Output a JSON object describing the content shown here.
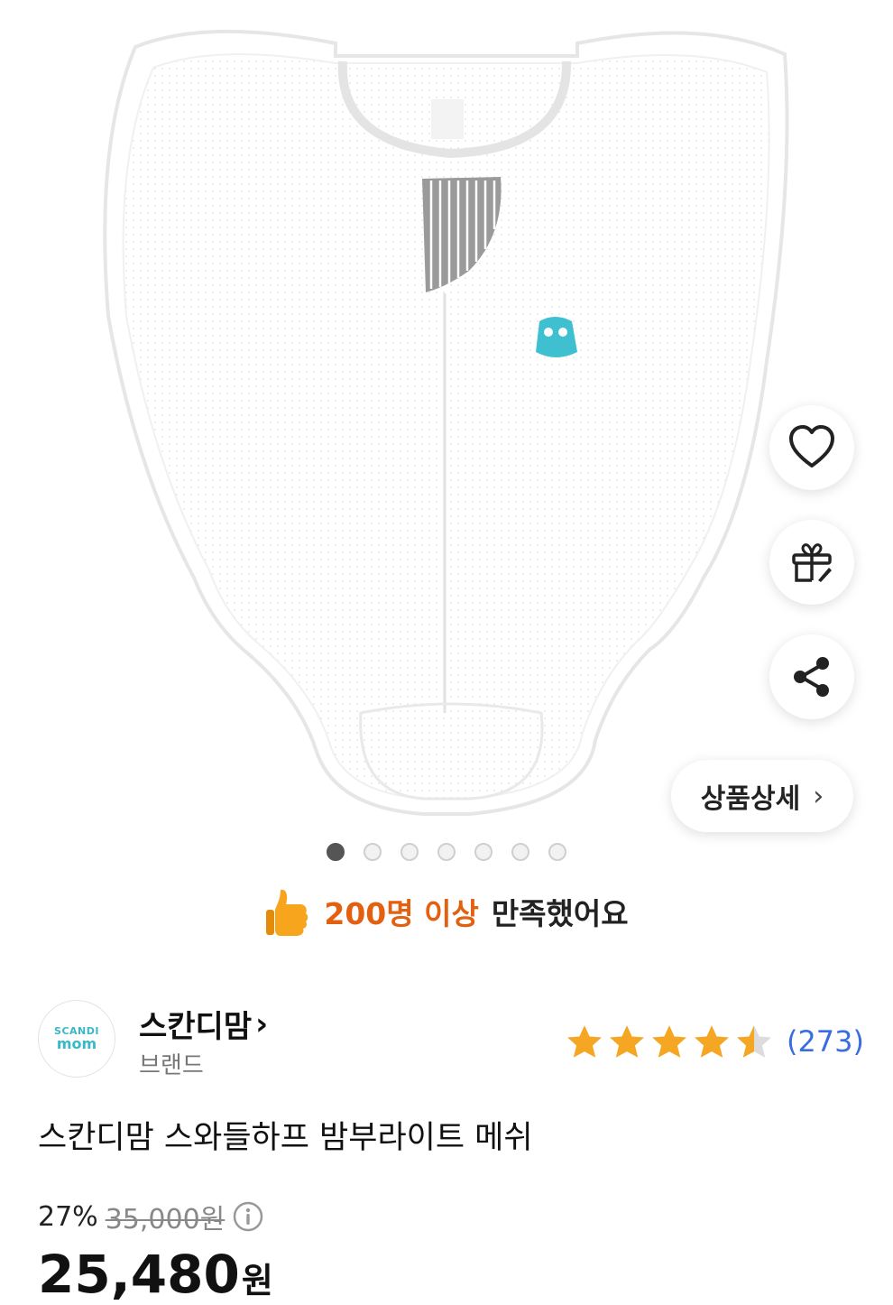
{
  "product_images": {
    "current": 1,
    "total": 7
  },
  "detail_button": {
    "label": "상품상세",
    "chevron": "›"
  },
  "satisfaction": {
    "highlight": "200명 이상",
    "rest": "만족했어요"
  },
  "brand": {
    "logo_line1": "SCANDI",
    "logo_line2": "mom",
    "name": "스칸디맘",
    "chevron": "›",
    "subtitle": "브랜드"
  },
  "rating": {
    "stars": 4.5,
    "count": "(273)"
  },
  "product": {
    "title": "스칸디맘 스와들하프 밤부라이트 메쉬",
    "discount": "27%",
    "original_price": "35,000원",
    "final_price": "25,480",
    "currency": "원"
  },
  "colors": {
    "accent_orange": "#e2600f",
    "star": "#f5a623",
    "rating_blue": "#3a6ee0",
    "logo_teal": "#38b8c8"
  }
}
